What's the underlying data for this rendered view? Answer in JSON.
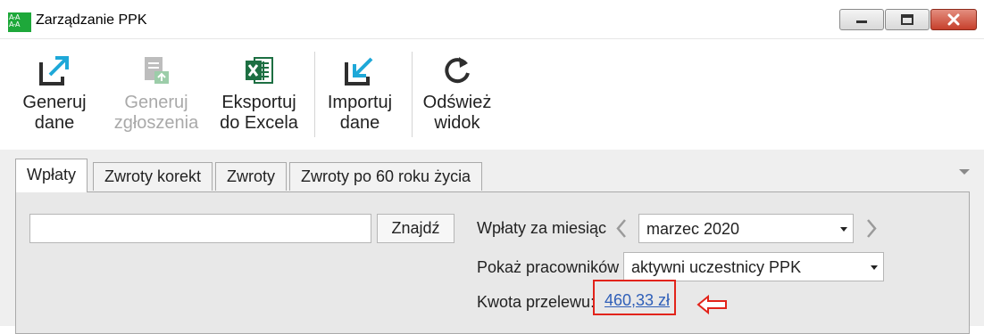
{
  "window": {
    "title": "Zarządzanie PPK",
    "icon_text": "A-A A-A"
  },
  "ribbon": {
    "buttons": [
      {
        "line1": "Generuj",
        "line2": "dane",
        "icon": "export-icon",
        "enabled": true
      },
      {
        "line1": "Generuj",
        "line2": "zgłoszenia",
        "icon": "document-upload-icon",
        "enabled": false
      },
      {
        "line1": "Eksportuj",
        "line2": "do Excela",
        "icon": "excel-icon",
        "enabled": true
      },
      {
        "line1": "Importuj",
        "line2": "dane",
        "icon": "import-icon",
        "enabled": true
      },
      {
        "line1": "Odśwież",
        "line2": "widok",
        "icon": "refresh-icon",
        "enabled": true
      }
    ]
  },
  "tabs": [
    {
      "label": "Wpłaty",
      "active": true
    },
    {
      "label": "Zwroty korekt",
      "active": false
    },
    {
      "label": "Zwroty",
      "active": false
    },
    {
      "label": "Zwroty po 60 roku życia",
      "active": false
    }
  ],
  "panel": {
    "search": {
      "value": "",
      "button": "Znajdź"
    },
    "month_label": "Wpłaty za miesiąc",
    "month_value": "marzec 2020",
    "employees_label": "Pokaż pracowników",
    "employees_value": "aktywni uczestnicy PPK",
    "transfer_label": "Kwota przelewu:",
    "transfer_amount": "460,33 zł"
  },
  "colors": {
    "accent_link": "#2f5fb8",
    "highlight": "#e2231a",
    "ribbon_icon": "#2e2e2e",
    "excel_icon": "#1d6f42"
  }
}
